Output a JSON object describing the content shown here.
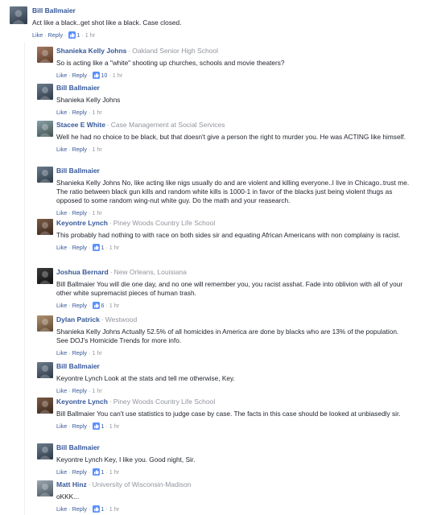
{
  "colors": {
    "link": "#365899",
    "meta": "#90949c",
    "text": "#1d2129"
  },
  "labels": {
    "like": "Like",
    "reply": "Reply"
  },
  "top_comment": {
    "author": "Bill Ballmaier",
    "text": "Act like a black..get shot like a black. Case closed.",
    "likes": "1",
    "time": "1 hr"
  },
  "replies": [
    {
      "author": "Shanieka Kelly Johns",
      "affiliation": "Oakland Senior High School",
      "text": "So is acting like a \"white\" shooting up churches, schools and movie theaters?",
      "likes": "10",
      "time": "1 hr"
    },
    {
      "author": "Bill Ballmaier",
      "affiliation": "",
      "text": "Shanieka Kelly Johns",
      "likes": "",
      "time": "1 hr"
    },
    {
      "author": "Stacee E White",
      "affiliation": "Case Management at Social Services",
      "text": "Well he had no choice to be black, but that doesn't give a person the right to murder you. He was ACTING like himself.",
      "likes": "",
      "time": "1 hr"
    },
    {
      "author": "Bill Ballmaier",
      "affiliation": "",
      "text": "Shanieka Kelly Johns No, like acting like nigs usually do and are violent and killing everyone..I live in Chicago..trust me. The ratio between black gun kills and random white kills is 1000-1 in favor of the blacks just being violent thugs as opposed to some random wing-nut white guy. Do the math and your reasearch.",
      "likes": "",
      "time": "1 hr"
    },
    {
      "author": "Keyontre Lynch",
      "affiliation": "Piney Woods Country Life School",
      "text": "This probably had nothing to with race on both sides sir and equating African Americans with non complainy is racist.",
      "likes": "1",
      "time": "1 hr"
    },
    {
      "author": "Joshua Bernard",
      "affiliation": "New Orleans, Louisiana",
      "text": "Bill Ballmaier You will die one day, and no one will remember you, you racist asshat. Fade into oblivion with all of your other white supremacist pieces of human trash.",
      "likes": "6",
      "time": "1 hr"
    },
    {
      "author": "Dylan Patrick",
      "affiliation": "Westwood",
      "text": "Shanieka Kelly Johns Actually 52.5% of all homicides in America are done by blacks who are 13% of the population. See DOJ's Homicide Trends for more info.",
      "likes": "",
      "time": "1 hr"
    },
    {
      "author": "Bill Ballmaier",
      "affiliation": "",
      "text": "Keyontre Lynch Look at the stats and tell me otherwise, Key.",
      "likes": "",
      "time": "1 hr"
    },
    {
      "author": "Keyontre Lynch",
      "affiliation": "Piney Woods Country Life School",
      "text": "Bill Ballmaier You can't use statistics to judge case by case. The facts in this case should be looked at unbiasedly sir.",
      "likes": "1",
      "time": "1 hr"
    },
    {
      "author": "Bill Ballmaier",
      "affiliation": "",
      "text": "Keyontre Lynch Key, I like you. Good night, Sir.",
      "likes": "1",
      "time": "1 hr"
    },
    {
      "author": "Matt Hinz",
      "affiliation": "University of Wisconsin-Madison",
      "text": "oKKK...",
      "likes": "1",
      "time": "1 hr"
    }
  ]
}
